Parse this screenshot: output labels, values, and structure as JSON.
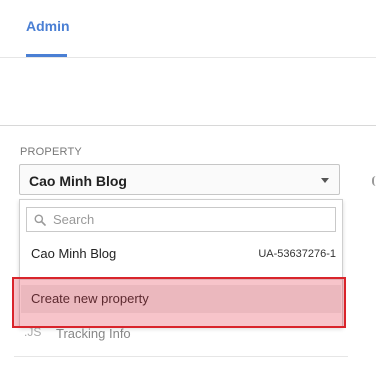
{
  "tabs": {
    "admin_label": "Admin"
  },
  "property": {
    "section_label": "PROPERTY",
    "selected": "Cao Minh Blog"
  },
  "dropdown": {
    "search_placeholder": "Search",
    "options": [
      {
        "name": "Cao Minh Blog",
        "id": "UA-53637276-1"
      }
    ],
    "create_label": "Create new property"
  },
  "background_list": {
    "tracking_icon_text": ".JS",
    "tracking_label": "Tracking Info"
  },
  "colors": {
    "accent": "#4a7fd4",
    "highlight_border": "#d9242b",
    "highlight_fill": "#e63c50"
  }
}
